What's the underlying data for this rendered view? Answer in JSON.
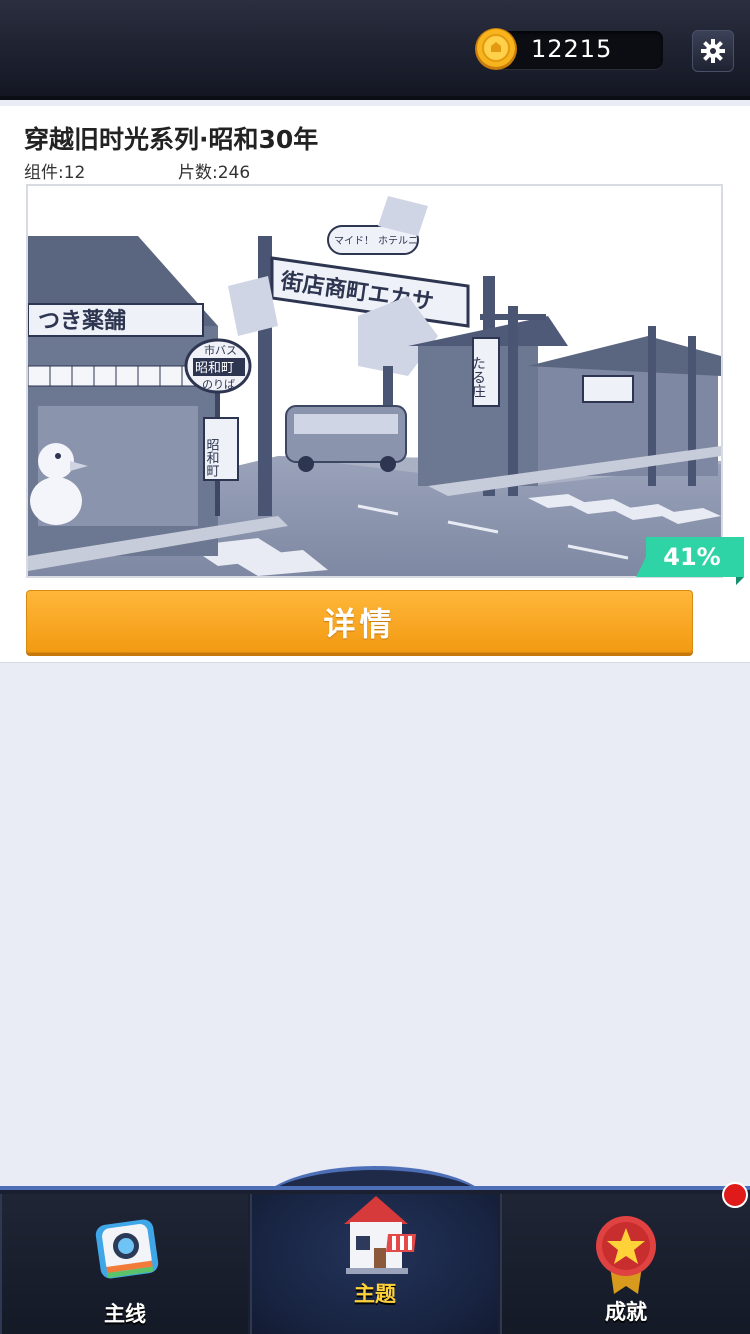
{
  "header": {
    "coins": "12215",
    "coin_icon": "gold-coin-icon",
    "settings_icon": "gear-icon"
  },
  "theme_card": {
    "title": "穿越旧时光系列·昭和30年",
    "parts_label": "组件:",
    "parts_value": "12",
    "pieces_label": "片数:",
    "pieces_value": "246",
    "progress": "41%",
    "progress_fraction": 0.41,
    "detail_button": "详情",
    "scene_signs": {
      "pharmacy": "つき薬舗",
      "bus_top": "市バス",
      "bus_main": "昭和町",
      "bus_bottom": "のりば",
      "arch_small": "マイド！",
      "arch_main": "街店商町エカサ",
      "arch_right": "ホテルニ",
      "shop": "たる庄",
      "post_sign": "昭和町"
    }
  },
  "bottom_nav": {
    "tabs": [
      {
        "label": "主线",
        "icon": "camera-icon"
      },
      {
        "label": "主题",
        "icon": "house-icon"
      },
      {
        "label": "成就",
        "icon": "star-medal-icon"
      }
    ],
    "active_index": 1,
    "badge_color": "#e01919"
  },
  "colors": {
    "accent_orange": "#f5a623",
    "progress_teal": "#2ecfa0",
    "nav_bg": "#1a2030"
  }
}
